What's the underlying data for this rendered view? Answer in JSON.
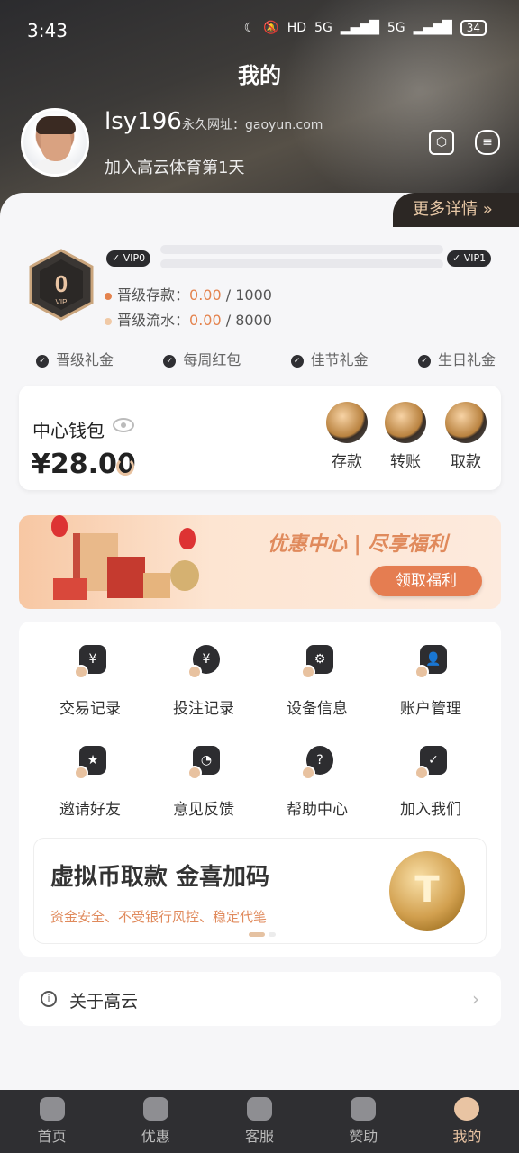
{
  "status": {
    "time": "3:43",
    "hd": "HD",
    "net1": "5G",
    "net2": "5G",
    "battery": "34"
  },
  "header": {
    "title": "我的",
    "username": "lsy196",
    "permalink": "永久网址：gaoyun.com",
    "joined": "加入高云体育第1天"
  },
  "more_details": "更多详情 »",
  "vip": {
    "badge": "0",
    "badge_sub": "VIP",
    "current_label": "VIP0",
    "next_label": "VIP1",
    "deposit_label": "晋级存款：",
    "deposit_value": "0.00",
    "deposit_target": " / 1000",
    "turnover_label": "晋级流水：",
    "turnover_value": "0.00",
    "turnover_target": " / 8000",
    "progress_deposit": 0,
    "progress_turnover": 0,
    "perks": [
      "晋级礼金",
      "每周红包",
      "佳节礼金",
      "生日礼金"
    ]
  },
  "wallet": {
    "title": "中心钱包",
    "amount": "¥28.00",
    "actions": [
      "存款",
      "转账",
      "取款"
    ]
  },
  "banner": {
    "slogan": "优惠中心 | 尽享福利",
    "cta": "领取福利"
  },
  "menu": {
    "items": [
      {
        "label": "交易记录",
        "icon": "¥"
      },
      {
        "label": "投注记录",
        "icon": "¥"
      },
      {
        "label": "设备信息",
        "icon": "⚙"
      },
      {
        "label": "账户管理",
        "icon": "👤"
      },
      {
        "label": "邀请好友",
        "icon": "★"
      },
      {
        "label": "意见反馈",
        "icon": "◔"
      },
      {
        "label": "帮助中心",
        "icon": "?"
      },
      {
        "label": "加入我们",
        "icon": "✓"
      }
    ]
  },
  "crypto": {
    "title": "虚拟币取款  金喜加码",
    "subtitle": "资金安全、不受银行风控、稳定代笔",
    "coin_symbol": "T"
  },
  "about": {
    "label": "关于高云",
    "chevron": "›"
  },
  "tabbar": {
    "tabs": [
      "首页",
      "优惠",
      "客服",
      "赞助",
      "我的"
    ],
    "active": 4
  },
  "colors": {
    "accent": "#e57d51",
    "gold": "#e9c4a3",
    "dark": "#2f2f32"
  }
}
